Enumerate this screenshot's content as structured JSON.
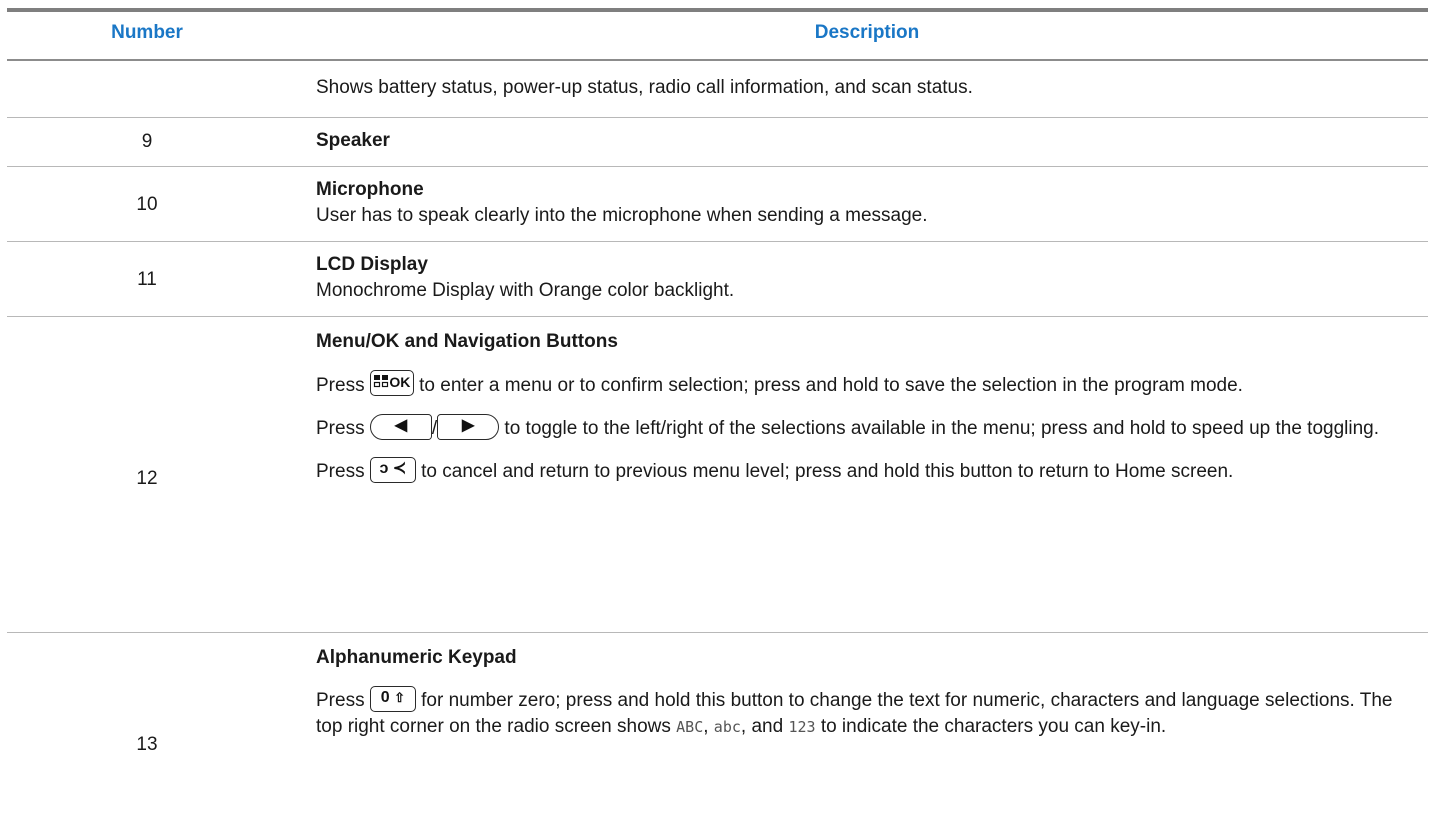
{
  "header": {
    "number": "Number",
    "description": "Description"
  },
  "rows": [
    {
      "number": "",
      "description": "Shows battery status, power-up status, radio call information, and scan status."
    },
    {
      "number": "9",
      "title": "Speaker"
    },
    {
      "number": "10",
      "title": "Microphone",
      "description": "User has to speak clearly into the microphone when sending a message."
    },
    {
      "number": "11",
      "title": "LCD Display",
      "description": "Monochrome Display with Orange color backlight."
    },
    {
      "number": "12",
      "title": "Menu/OK and Navigation Buttons",
      "p1_pre": "Press",
      "p1_post": "to enter a menu or to confirm selection; press and hold to save the selection in the program mode.",
      "p2_pre": "Press",
      "p2_slash": "/",
      "p2_post": "to toggle to the left/right of the selections available in the menu; press and hold to speed up the toggling.",
      "p3_pre": "Press",
      "p3_post": "to cancel and return to previous menu level; press and hold this button to return to Home screen."
    },
    {
      "number": "13",
      "title": "Alphanumeric Keypad",
      "p1_pre": "Press",
      "p1_post": "for number zero; press and hold this button to change the text for numeric, characters and language selections. The top right corner on the radio screen shows",
      "mode1": "ABC",
      "sep1": ",",
      "mode2": "abc",
      "sep2": ", and",
      "mode3": "123",
      "tail": "to indicate the characters you can key-in."
    }
  ],
  "keys": {
    "menu_ok_label": "OK",
    "left_arrow": "◀",
    "right_arrow": "▶",
    "back_label": "ↄ ≺",
    "zero_label": "0",
    "shift_label": "⇧"
  },
  "colors": {
    "header_text": "#1a77c6",
    "rule": "#7f7f7f"
  },
  "icons": [
    "menu-ok-key-icon",
    "left-arrow-key-icon",
    "right-arrow-key-icon",
    "back-key-icon",
    "zero-shift-key-icon"
  ]
}
